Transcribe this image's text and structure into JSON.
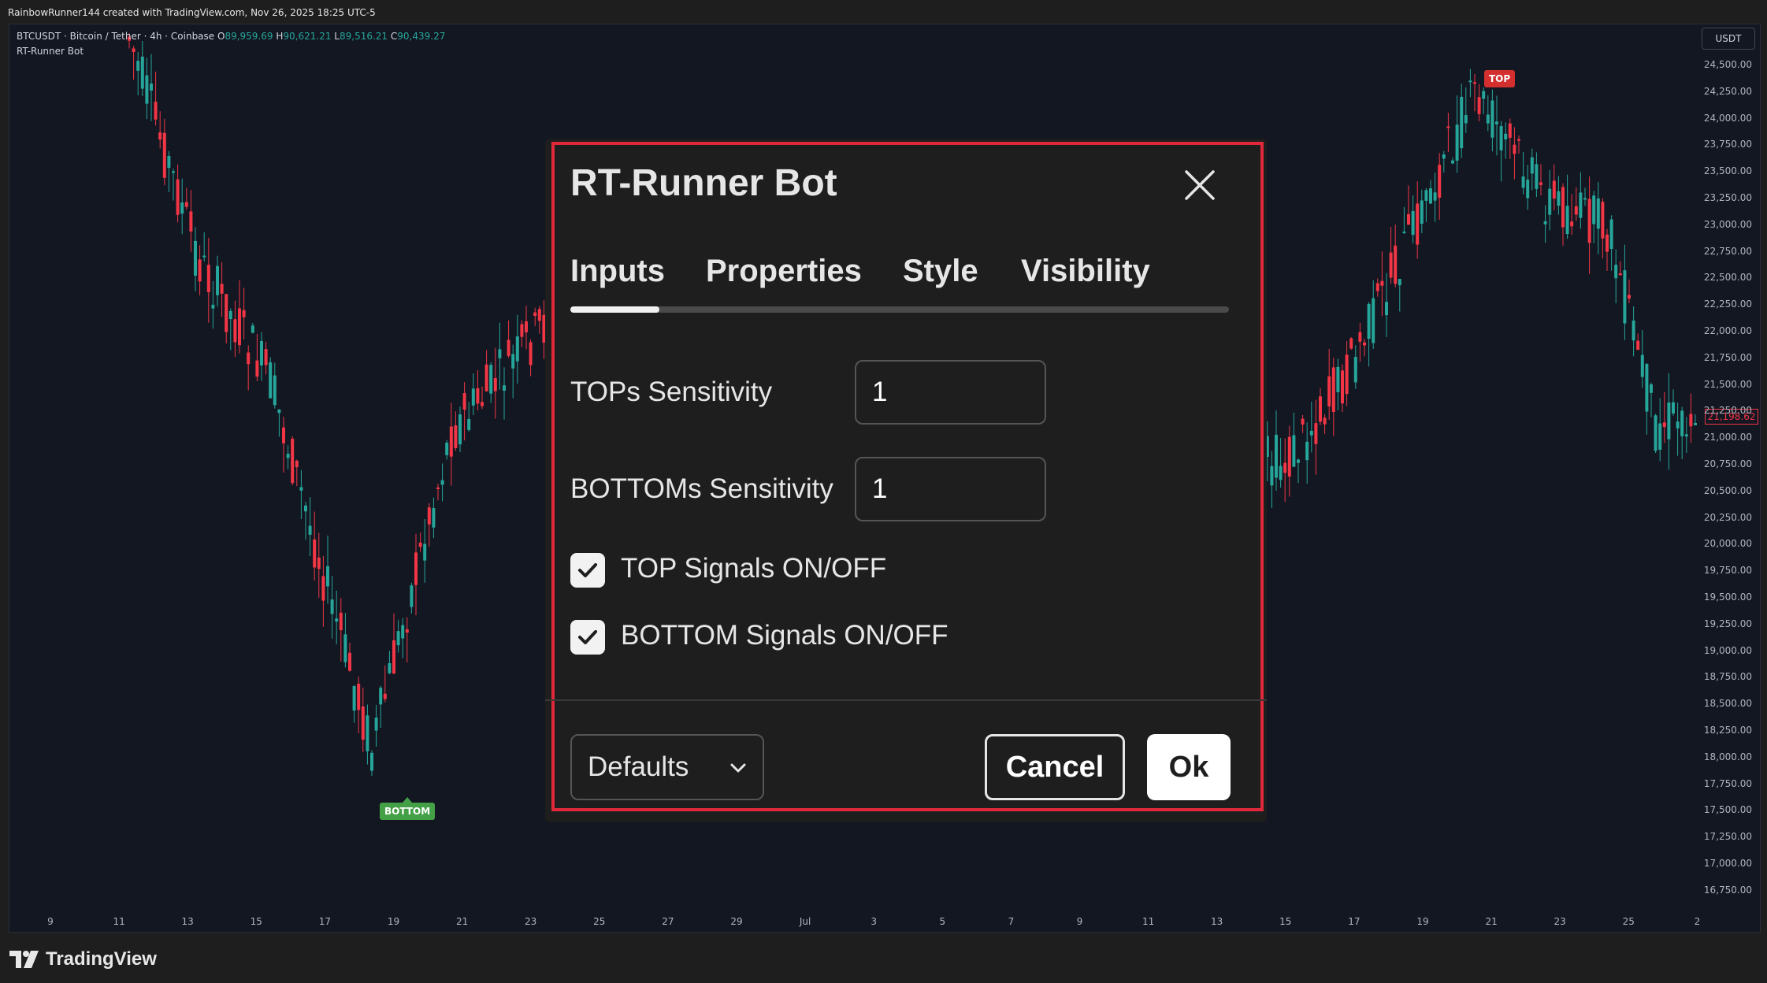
{
  "window": {
    "attribution": "RainbowRunner144 created with TradingView.com, Nov 26, 2025 18:25 UTC-5"
  },
  "chart": {
    "symbol_text": "BTCUSDT · Bitcoin / Tether · 4h · Coinbase",
    "open_label": "O",
    "open": "89,959.69",
    "high_label": "H",
    "high": "90,621.21",
    "low_label": "L",
    "low": "89,516.21",
    "close_label": "C",
    "close": "90,439.27",
    "indicator": "RT-Runner Bot",
    "currency": "USDT",
    "current_price": "21,198.62",
    "price_labels": [
      "24,500.00",
      "24,250.00",
      "24,000.00",
      "23,750.00",
      "23,500.00",
      "23,250.00",
      "23,000.00",
      "22,750.00",
      "22,500.00",
      "22,250.00",
      "22,000.00",
      "21,750.00",
      "21,500.00",
      "21,250.00",
      "21,000.00",
      "20,750.00",
      "20,500.00",
      "20,250.00",
      "20,000.00",
      "19,750.00",
      "19,500.00",
      "19,250.00",
      "19,000.00",
      "18,750.00",
      "18,500.00",
      "18,250.00",
      "18,000.00",
      "17,750.00",
      "17,500.00",
      "17,250.00",
      "17,000.00",
      "16,750.00"
    ],
    "time_labels": [
      "9",
      "11",
      "13",
      "15",
      "17",
      "19",
      "21",
      "23",
      "25",
      "27",
      "29",
      "Jul",
      "3",
      "5",
      "7",
      "9",
      "11",
      "13",
      "15",
      "17",
      "19",
      "21",
      "23",
      "25",
      "2"
    ],
    "signal_top": "TOP",
    "signal_bottom": "BOTTOM",
    "up_color": "#26a69a",
    "down_color": "#f23645"
  },
  "dialog": {
    "title": "RT-Runner Bot",
    "tabs": [
      {
        "label": "Inputs",
        "active": true
      },
      {
        "label": "Properties",
        "active": false
      },
      {
        "label": "Style",
        "active": false
      },
      {
        "label": "Visibility",
        "active": false
      }
    ],
    "inputs": [
      {
        "label": "TOPs Sensitivity",
        "value": "1"
      },
      {
        "label": "BOTTOMs Sensitivity",
        "value": "1"
      }
    ],
    "checkboxes": [
      {
        "label": "TOP Signals ON/OFF",
        "checked": true
      },
      {
        "label": "BOTTOM Signals ON/OFF",
        "checked": true
      }
    ],
    "defaults_label": "Defaults",
    "cancel_label": "Cancel",
    "ok_label": "Ok",
    "highlight_color": "#e0283a"
  },
  "footer": {
    "brand": "TradingView"
  }
}
